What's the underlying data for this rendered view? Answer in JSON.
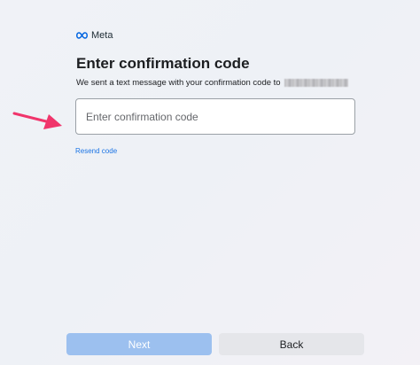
{
  "brand": {
    "name": "Meta",
    "logo_color": "#0064e0"
  },
  "header": {
    "title": "Enter confirmation code",
    "subtitle": "We sent a text message with your confirmation code to"
  },
  "code_field": {
    "placeholder": "Enter confirmation code",
    "value": ""
  },
  "resend_link": "Resend code",
  "buttons": {
    "next": "Next",
    "back": "Back"
  },
  "annotation": {
    "arrow_color": "#f0356b",
    "arrow_icon": "arrow-right-icon"
  },
  "colors": {
    "accent": "#1b74e4",
    "next_disabled_bg": "#9cc0ef",
    "back_bg": "#e5e6ea"
  }
}
